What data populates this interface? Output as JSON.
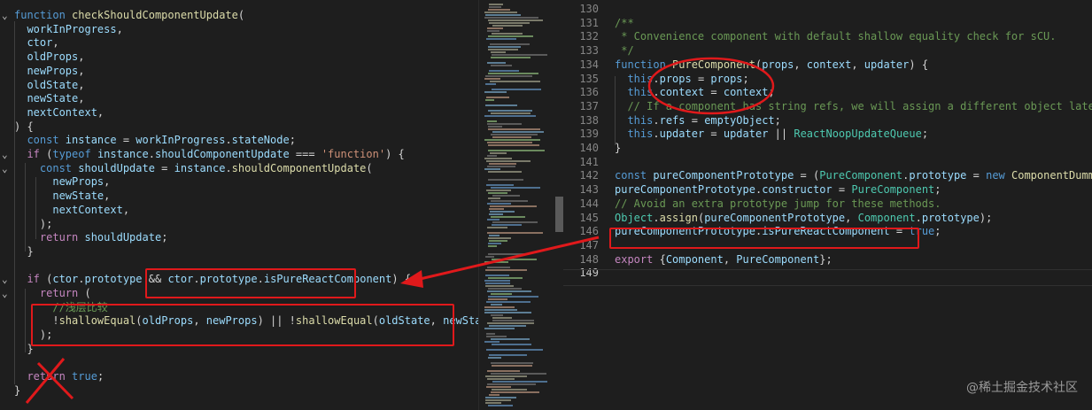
{
  "left_code": [
    {
      "fold": "v",
      "tokens": [
        [
          "kw",
          "function "
        ],
        [
          "fn",
          "checkShouldComponentUpdate"
        ],
        [
          "pun",
          "("
        ]
      ]
    },
    {
      "tokens": [
        [
          "var",
          "  workInProgress"
        ],
        [
          "pun",
          ","
        ]
      ]
    },
    {
      "tokens": [
        [
          "var",
          "  ctor"
        ],
        [
          "pun",
          ","
        ]
      ]
    },
    {
      "tokens": [
        [
          "var",
          "  oldProps"
        ],
        [
          "pun",
          ","
        ]
      ]
    },
    {
      "tokens": [
        [
          "var",
          "  newProps"
        ],
        [
          "pun",
          ","
        ]
      ]
    },
    {
      "tokens": [
        [
          "var",
          "  oldState"
        ],
        [
          "pun",
          ","
        ]
      ]
    },
    {
      "tokens": [
        [
          "var",
          "  newState"
        ],
        [
          "pun",
          ","
        ]
      ]
    },
    {
      "tokens": [
        [
          "var",
          "  nextContext"
        ],
        [
          "pun",
          ","
        ]
      ]
    },
    {
      "tokens": [
        [
          "pun",
          ") {"
        ]
      ]
    },
    {
      "tokens": [
        [
          "kw",
          "  const "
        ],
        [
          "var",
          "instance"
        ],
        [
          "pun",
          " = "
        ],
        [
          "var",
          "workInProgress"
        ],
        [
          "pun",
          "."
        ],
        [
          "var",
          "stateNode"
        ],
        [
          "pun",
          ";"
        ]
      ]
    },
    {
      "fold": "v",
      "tokens": [
        [
          "ctl",
          "  if "
        ],
        [
          "pun",
          "("
        ],
        [
          "kw",
          "typeof "
        ],
        [
          "var",
          "instance"
        ],
        [
          "pun",
          "."
        ],
        [
          "var",
          "shouldComponentUpdate"
        ],
        [
          "pun",
          " === "
        ],
        [
          "str",
          "'function'"
        ],
        [
          "pun",
          ") {"
        ]
      ]
    },
    {
      "fold": "v",
      "tokens": [
        [
          "kw",
          "    const "
        ],
        [
          "var",
          "shouldUpdate"
        ],
        [
          "pun",
          " = "
        ],
        [
          "var",
          "instance"
        ],
        [
          "pun",
          "."
        ],
        [
          "fn",
          "shouldComponentUpdate"
        ],
        [
          "pun",
          "("
        ]
      ]
    },
    {
      "tokens": [
        [
          "var",
          "      newProps"
        ],
        [
          "pun",
          ","
        ]
      ]
    },
    {
      "tokens": [
        [
          "var",
          "      newState"
        ],
        [
          "pun",
          ","
        ]
      ]
    },
    {
      "tokens": [
        [
          "var",
          "      nextContext"
        ],
        [
          "pun",
          ","
        ]
      ]
    },
    {
      "tokens": [
        [
          "pun",
          "    );"
        ]
      ]
    },
    {
      "tokens": [
        [
          "ctl",
          "    return "
        ],
        [
          "var",
          "shouldUpdate"
        ],
        [
          "pun",
          ";"
        ]
      ]
    },
    {
      "tokens": [
        [
          "pun",
          "  }"
        ]
      ]
    },
    {
      "tokens": []
    },
    {
      "fold": "v",
      "tokens": [
        [
          "ctl",
          "  if "
        ],
        [
          "pun",
          "("
        ],
        [
          "var",
          "ctor"
        ],
        [
          "pun",
          "."
        ],
        [
          "var",
          "prototype"
        ],
        [
          "pun",
          " && "
        ],
        [
          "var",
          "ctor"
        ],
        [
          "pun",
          "."
        ],
        [
          "var",
          "prototype"
        ],
        [
          "pun",
          "."
        ],
        [
          "var",
          "isPureReactComponent"
        ],
        [
          "pun",
          ") {"
        ]
      ]
    },
    {
      "fold": "v",
      "tokens": [
        [
          "ctl",
          "    return "
        ],
        [
          "pun",
          "("
        ]
      ]
    },
    {
      "tokens": [
        [
          "com",
          "      //浅层比较"
        ]
      ]
    },
    {
      "tokens": [
        [
          "pun",
          "      !"
        ],
        [
          "fn",
          "shallowEqual"
        ],
        [
          "pun",
          "("
        ],
        [
          "var",
          "oldProps"
        ],
        [
          "pun",
          ", "
        ],
        [
          "var",
          "newProps"
        ],
        [
          "pun",
          ") || !"
        ],
        [
          "fn",
          "shallowEqual"
        ],
        [
          "pun",
          "("
        ],
        [
          "var",
          "oldState"
        ],
        [
          "pun",
          ", "
        ],
        [
          "var",
          "newState"
        ],
        [
          "pun",
          ")"
        ]
      ]
    },
    {
      "tokens": [
        [
          "pun",
          "    );"
        ]
      ]
    },
    {
      "tokens": [
        [
          "pun",
          "  }"
        ]
      ]
    },
    {
      "tokens": []
    },
    {
      "tokens": [
        [
          "ctl",
          "  return "
        ],
        [
          "kw",
          "true"
        ],
        [
          "pun",
          ";"
        ]
      ]
    },
    {
      "tokens": [
        [
          "pun",
          "}"
        ]
      ]
    }
  ],
  "right_code": [
    {
      "num": "130",
      "tokens": []
    },
    {
      "num": "131",
      "tokens": [
        [
          "com",
          "/**"
        ]
      ]
    },
    {
      "num": "132",
      "tokens": [
        [
          "com",
          " * Convenience component with default shallow equality check for sCU."
        ]
      ]
    },
    {
      "num": "133",
      "tokens": [
        [
          "com",
          " */"
        ]
      ]
    },
    {
      "num": "134",
      "tokens": [
        [
          "kw",
          "function "
        ],
        [
          "fn",
          "PureComponent"
        ],
        [
          "pun",
          "("
        ],
        [
          "var",
          "props"
        ],
        [
          "pun",
          ", "
        ],
        [
          "var",
          "context"
        ],
        [
          "pun",
          ", "
        ],
        [
          "var",
          "updater"
        ],
        [
          "pun",
          ") {"
        ]
      ]
    },
    {
      "num": "135",
      "tokens": [
        [
          "kw",
          "  this"
        ],
        [
          "pun",
          "."
        ],
        [
          "var",
          "props"
        ],
        [
          "pun",
          " = "
        ],
        [
          "var",
          "props"
        ],
        [
          "pun",
          ";"
        ]
      ]
    },
    {
      "num": "136",
      "tokens": [
        [
          "kw",
          "  this"
        ],
        [
          "pun",
          "."
        ],
        [
          "var",
          "context"
        ],
        [
          "pun",
          " = "
        ],
        [
          "var",
          "context"
        ],
        [
          "pun",
          ";"
        ]
      ]
    },
    {
      "num": "137",
      "tokens": [
        [
          "com",
          "  // If a component has string refs, we will assign a different object later."
        ]
      ]
    },
    {
      "num": "138",
      "tokens": [
        [
          "kw",
          "  this"
        ],
        [
          "pun",
          "."
        ],
        [
          "var",
          "refs"
        ],
        [
          "pun",
          " = "
        ],
        [
          "var",
          "emptyObject"
        ],
        [
          "pun",
          ";"
        ]
      ]
    },
    {
      "num": "139",
      "tokens": [
        [
          "kw",
          "  this"
        ],
        [
          "pun",
          "."
        ],
        [
          "var",
          "updater"
        ],
        [
          "pun",
          " = "
        ],
        [
          "var",
          "updater"
        ],
        [
          "pun",
          " || "
        ],
        [
          "cls",
          "ReactNoopUpdateQueue"
        ],
        [
          "pun",
          ";"
        ]
      ]
    },
    {
      "num": "140",
      "tokens": [
        [
          "pun",
          "}"
        ]
      ]
    },
    {
      "num": "141",
      "tokens": []
    },
    {
      "num": "142",
      "tokens": [
        [
          "kw",
          "const "
        ],
        [
          "var",
          "pureComponentPrototype"
        ],
        [
          "pun",
          " = ("
        ],
        [
          "cls",
          "PureComponent"
        ],
        [
          "pun",
          "."
        ],
        [
          "var",
          "prototype"
        ],
        [
          "pun",
          " = "
        ],
        [
          "kw",
          "new "
        ],
        [
          "fn",
          "ComponentDummy"
        ],
        [
          "pun",
          "());"
        ]
      ]
    },
    {
      "num": "143",
      "tokens": [
        [
          "var",
          "pureComponentPrototype"
        ],
        [
          "pun",
          "."
        ],
        [
          "var",
          "constructor"
        ],
        [
          "pun",
          " = "
        ],
        [
          "cls",
          "PureComponent"
        ],
        [
          "pun",
          ";"
        ]
      ]
    },
    {
      "num": "144",
      "tokens": [
        [
          "com",
          "// Avoid an extra prototype jump for these methods."
        ]
      ]
    },
    {
      "num": "145",
      "tokens": [
        [
          "cls",
          "Object"
        ],
        [
          "pun",
          "."
        ],
        [
          "fn",
          "assign"
        ],
        [
          "pun",
          "("
        ],
        [
          "var",
          "pureComponentPrototype"
        ],
        [
          "pun",
          ", "
        ],
        [
          "cls",
          "Component"
        ],
        [
          "pun",
          "."
        ],
        [
          "var",
          "prototype"
        ],
        [
          "pun",
          ");"
        ]
      ]
    },
    {
      "num": "146",
      "tokens": [
        [
          "var",
          "pureComponentPrototype"
        ],
        [
          "pun",
          "."
        ],
        [
          "var",
          "isPureReactComponent"
        ],
        [
          "pun",
          " = "
        ],
        [
          "kw",
          "true"
        ],
        [
          "pun",
          ";"
        ]
      ]
    },
    {
      "num": "147",
      "tokens": []
    },
    {
      "num": "148",
      "tokens": [
        [
          "ctl",
          "export "
        ],
        [
          "pun",
          "{"
        ],
        [
          "var",
          "Component"
        ],
        [
          "pun",
          ", "
        ],
        [
          "var",
          "PureComponent"
        ],
        [
          "pun",
          "};"
        ]
      ]
    },
    {
      "num": "149",
      "tokens": []
    }
  ],
  "watermark": "@稀土掘金技术社区"
}
